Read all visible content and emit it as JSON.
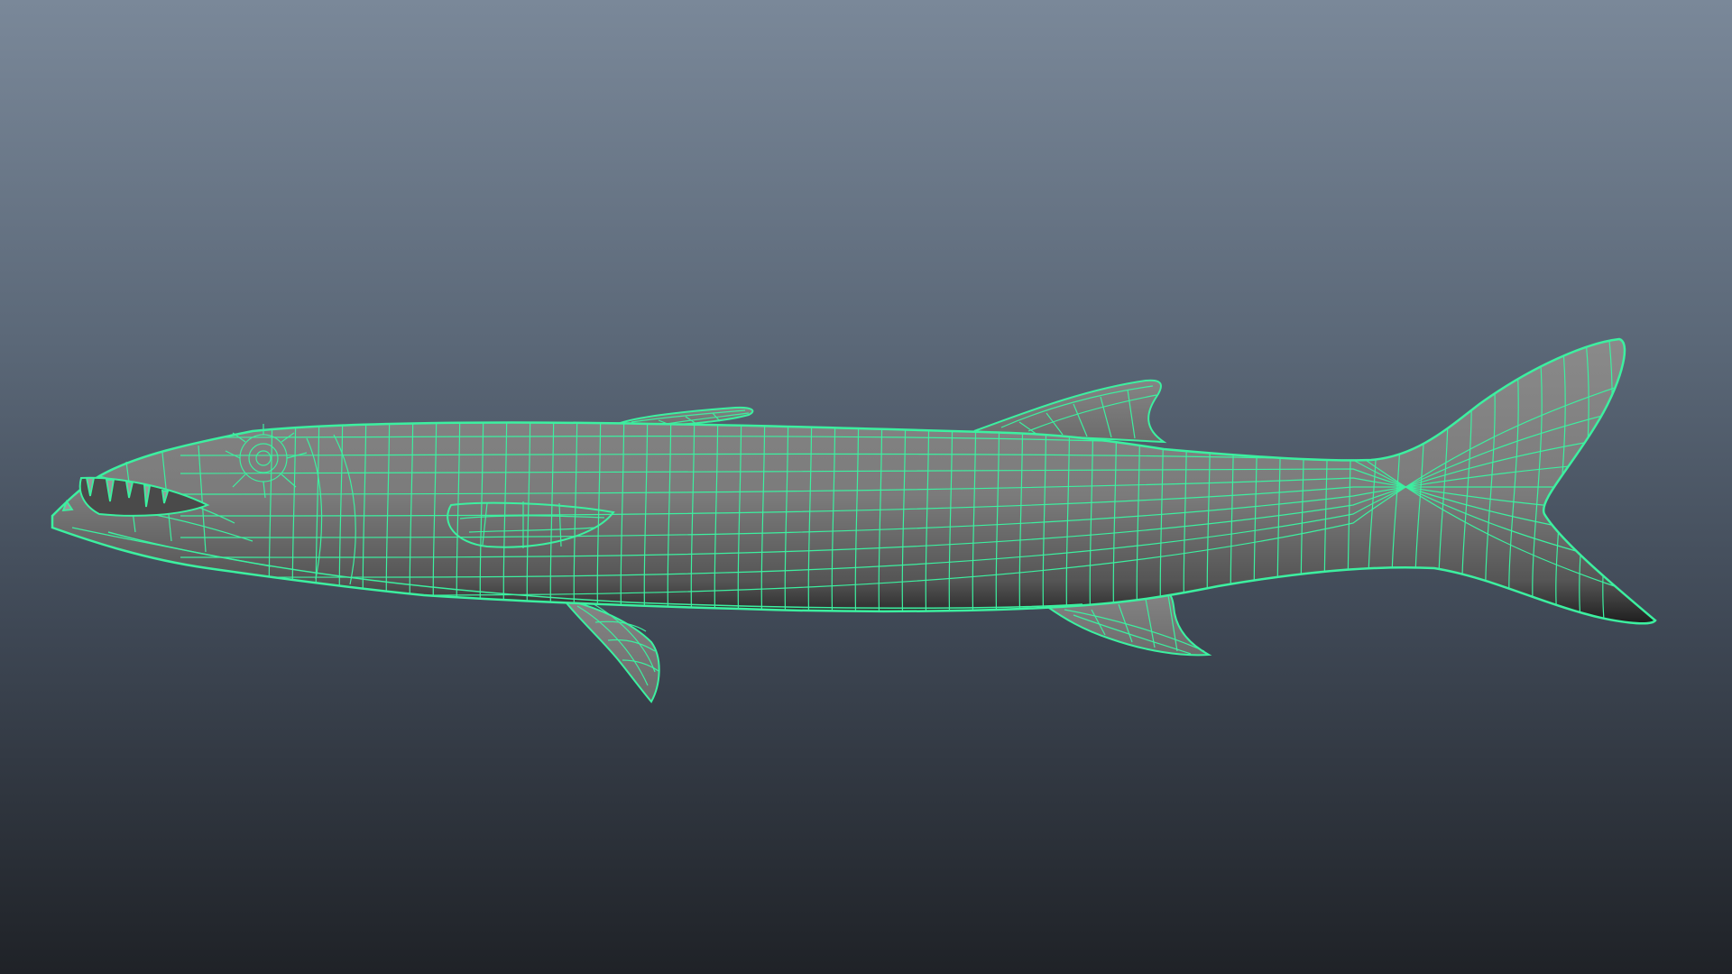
{
  "viewport": {
    "background_top": "#7a8899",
    "background_mid": "#5b6878",
    "background_bottom": "#1f2227"
  },
  "model": {
    "subject": "barracuda-fish-mesh",
    "display_mode": "wireframe-on-shaded",
    "wire_color": "#3cf0a0",
    "surface_color": "#7d7d7d",
    "surface_shadow_color": "#2f2f2f"
  }
}
